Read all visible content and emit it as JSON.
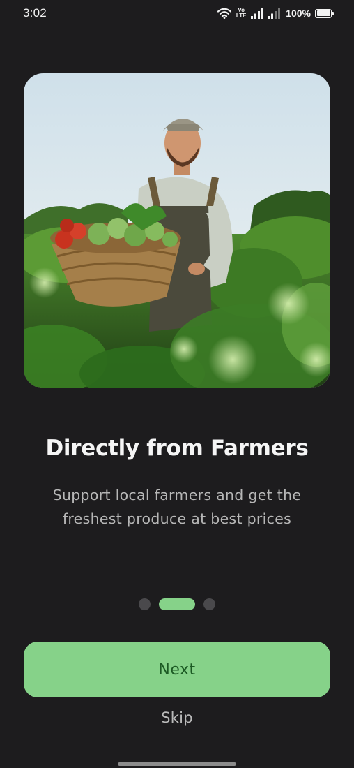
{
  "status_bar": {
    "time": "3:02",
    "volte_line1": "Vo",
    "volte_line2": "LTE",
    "battery_percent": "100%",
    "battery_level": 1.0
  },
  "onboarding": {
    "image_icon": "farmer-with-vegetable-basket-photo",
    "title": "Directly from Farmers",
    "subtitle": "Support local farmers and get the freshest produce at best prices",
    "page_count": 3,
    "current_page": 2
  },
  "actions": {
    "next_label": "Next",
    "skip_label": "Skip"
  },
  "colors": {
    "background": "#1d1c1e",
    "accent": "#86d289",
    "accent_text": "#1c5a24",
    "inactive_dot": "#4a494c"
  }
}
